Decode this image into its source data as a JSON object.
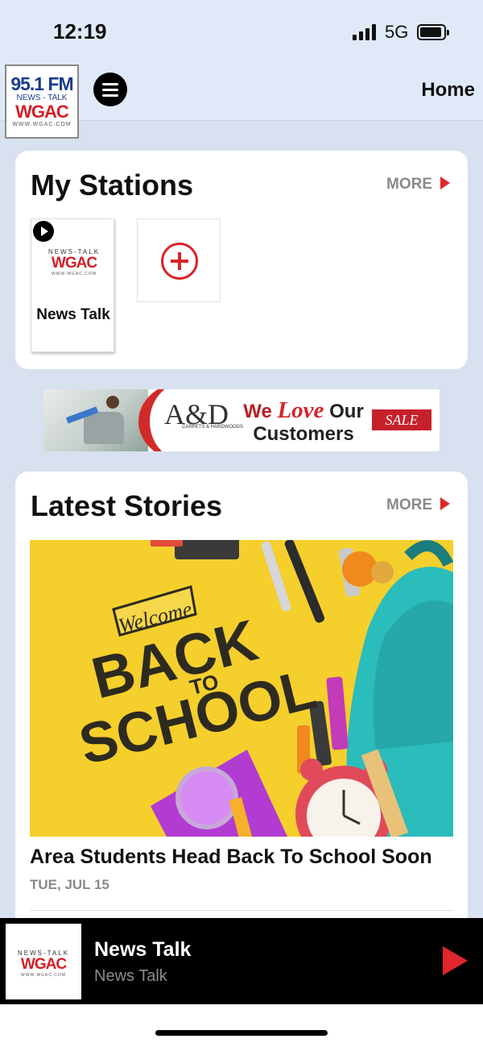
{
  "status_bar": {
    "time": "12:19",
    "network": "5G"
  },
  "header": {
    "logo": {
      "line1": "95.1 FM",
      "line2": "NEWS - TALK",
      "line3": "WGAC",
      "line4": "WWW.WGAC.COM"
    },
    "home_label": "Home"
  },
  "my_stations": {
    "title": "My Stations",
    "more_label": "MORE",
    "stations": [
      {
        "label": "News Talk",
        "logo": {
          "top": "NEWS-TALK",
          "call": "WGAC",
          "web": "WWW.WGAC.COM"
        }
      }
    ]
  },
  "ad": {
    "brand": "A&D",
    "brand_sub": "CARPETS & HARDWOODS",
    "text_we": "We",
    "text_love": "Love",
    "text_our": "Our",
    "text_customers": "Customers",
    "sale": "SALE"
  },
  "latest_stories": {
    "title": "Latest Stories",
    "more_label": "MORE",
    "stories": [
      {
        "image_text_welcome": "Welcome",
        "image_text_back": "BACK",
        "image_text_to": "TO",
        "image_text_school": "SCHOOL",
        "title": "Area Students Head Back To School Soon",
        "date": "TUE, JUL 15"
      }
    ]
  },
  "player": {
    "title": "News Talk",
    "subtitle": "News Talk",
    "logo_top": "NEWS-TALK",
    "logo_call": "WGAC",
    "logo_web": "WWW.WGAC.COM"
  },
  "colors": {
    "accent": "#e0252c",
    "background": "#d7e1ef",
    "header": "#dfe9f8"
  }
}
